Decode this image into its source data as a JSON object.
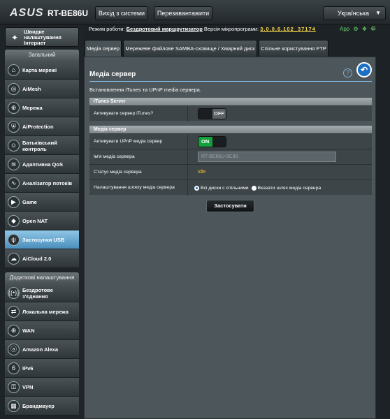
{
  "header": {
    "logo": "ASUS",
    "model": "RT-BE86U",
    "logout_label": "Вихід з системи",
    "reboot_label": "Перезавантажити",
    "language": "Українська"
  },
  "mode_line": {
    "mode_label": "Режим роботи:",
    "mode_value": "Бездротовий маршрутизатор",
    "firmware_label": "Версія мікропрограми:",
    "firmware_value": "3.0.0.6.102_37174",
    "app_label": "App"
  },
  "sidebar": {
    "quick_setup": "Швидке налаштування Інтернет",
    "general_header": "Загальний",
    "general_items": [
      {
        "label": "Карта мережі",
        "icon": "network-map-icon"
      },
      {
        "label": "AiMesh",
        "icon": "aimesh-icon"
      },
      {
        "label": "Мережа",
        "icon": "network-icon"
      },
      {
        "label": "AiProtection",
        "icon": "shield-icon"
      },
      {
        "label": "Батьківський контроль",
        "icon": "parental-icon"
      },
      {
        "label": "Адаптивна QoS",
        "icon": "qos-icon"
      },
      {
        "label": "Аналізатор потоків",
        "icon": "traffic-icon"
      },
      {
        "label": "Game",
        "icon": "game-icon"
      },
      {
        "label": "Open NAT",
        "icon": "opennat-icon"
      },
      {
        "label": "Застосунки USB",
        "icon": "usb-icon"
      },
      {
        "label": "AiCloud 2.0",
        "icon": "cloud-icon"
      }
    ],
    "advanced_header": "Додаткові налаштування",
    "advanced_items": [
      {
        "label": "Бездротове з'єднання",
        "icon": "wireless-icon"
      },
      {
        "label": "Локальна мережа",
        "icon": "lan-icon"
      },
      {
        "label": "WAN",
        "icon": "wan-icon"
      },
      {
        "label": "Amazon Alexa",
        "icon": "alexa-icon"
      },
      {
        "label": "IPv6",
        "icon": "ipv6-icon"
      },
      {
        "label": "VPN",
        "icon": "vpn-icon"
      },
      {
        "label": "Брандмауер",
        "icon": "firewall-icon"
      }
    ]
  },
  "tabs": [
    {
      "label": "Медіа сервер"
    },
    {
      "label": "Мережеве файлове SAMBA-сховище / Хмарний диск"
    },
    {
      "label": "Спільне користування FTP"
    }
  ],
  "main": {
    "title": "Медіа сервер",
    "description": "Встановлення iTunes та UPnP media сервера.",
    "itunes_header": "iTunes Server",
    "itunes_label": "Активувати сервер iTunes?",
    "itunes_state": "OFF",
    "media_header": "Медіа сервер",
    "upnp_label": "Активувати UPnP медіа сервер",
    "upnp_state": "ON",
    "name_label": "Ім'я медіа сервера",
    "name_value": "RT-BE86U-9C90",
    "status_label": "Статус медіа сервера",
    "status_value": "Idle",
    "path_label": "Налаштування шляху медіа сервера",
    "path_option_all": "Всі диски с спільними",
    "path_option_custom": "Вказати шлях медіа сервера",
    "apply_label": "Застосувати"
  }
}
